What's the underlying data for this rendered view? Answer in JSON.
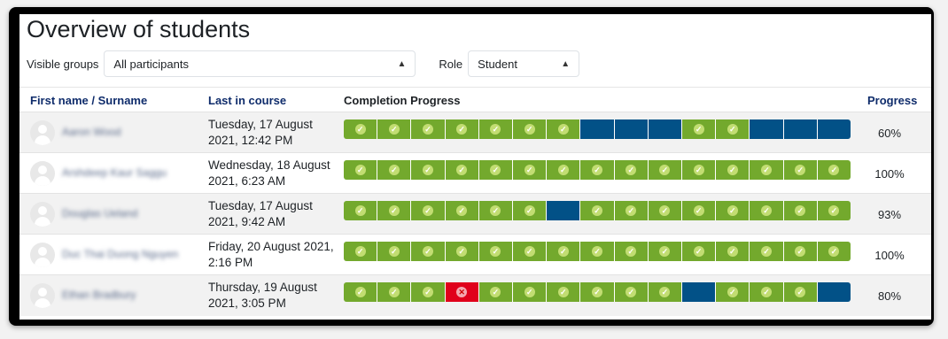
{
  "page": {
    "title": "Overview of students"
  },
  "filters": {
    "groups_label": "Visible groups",
    "groups_value": "All participants",
    "role_label": "Role",
    "role_value": "Student"
  },
  "table": {
    "headers": {
      "name": "First name / Surname",
      "last": "Last in course",
      "completion": "Completion Progress",
      "progress": "Progress"
    },
    "rows": [
      {
        "name": "Aaron Wood",
        "date": "Tuesday, 17 August 2021, 12:42 PM",
        "progress": "60%",
        "cells": [
          "complete",
          "complete",
          "complete",
          "complete",
          "complete",
          "complete",
          "complete",
          "notattempted",
          "notattempted",
          "notattempted",
          "complete",
          "complete",
          "notattempted",
          "notattempted",
          "notattempted"
        ]
      },
      {
        "name": "Arshdeep Kaur Saggu",
        "date": "Wednesday, 18 August 2021, 6:23 AM",
        "progress": "100%",
        "cells": [
          "complete",
          "complete",
          "complete",
          "complete",
          "complete",
          "complete",
          "complete",
          "complete",
          "complete",
          "complete",
          "complete",
          "complete",
          "complete",
          "complete",
          "complete"
        ]
      },
      {
        "name": "Douglas Ueland",
        "date": "Tuesday, 17 August 2021, 9:42 AM",
        "progress": "93%",
        "cells": [
          "complete",
          "complete",
          "complete",
          "complete",
          "complete",
          "complete",
          "notattempted",
          "complete",
          "complete",
          "complete",
          "complete",
          "complete",
          "complete",
          "complete",
          "complete"
        ]
      },
      {
        "name": "Duc Thai Duong Nguyen",
        "date": "Friday, 20 August 2021, 2:16 PM",
        "progress": "100%",
        "cells": [
          "complete",
          "complete",
          "complete",
          "complete",
          "complete",
          "complete",
          "complete",
          "complete",
          "complete",
          "complete",
          "complete",
          "complete",
          "complete",
          "complete",
          "complete"
        ]
      },
      {
        "name": "Ethan Bradbury",
        "date": "Thursday, 19 August 2021, 3:05 PM",
        "progress": "80%",
        "cells": [
          "complete",
          "complete",
          "complete",
          "failed",
          "complete",
          "complete",
          "complete",
          "complete",
          "complete",
          "complete",
          "notattempted",
          "complete",
          "complete",
          "complete",
          "notattempted"
        ]
      }
    ]
  },
  "icons": {
    "complete": "check-icon",
    "failed": "cross-icon",
    "select": "select-arrows-icon"
  },
  "colors": {
    "complete": "#73a92d",
    "not_attempted": "#025187",
    "failed": "#e0001b",
    "link": "#0f2c6b"
  }
}
